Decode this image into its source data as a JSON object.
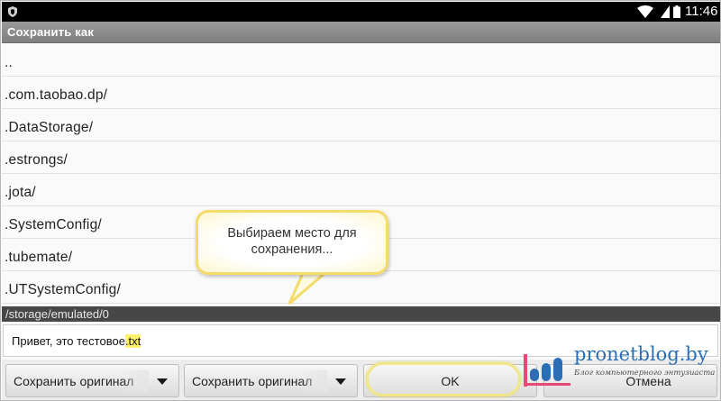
{
  "status_bar": {
    "time": "11:46",
    "icons": [
      "shield-icon",
      "wifi-icon",
      "signal-icon",
      "battery-icon"
    ]
  },
  "dialog": {
    "title": "Сохранить как"
  },
  "file_list": {
    "items": [
      {
        "label": ".."
      },
      {
        "label": ".com.taobao.dp/"
      },
      {
        "label": ".DataStorage/"
      },
      {
        "label": ".estrongs/"
      },
      {
        "label": ".jota/"
      },
      {
        "label": ".SystemConfig/"
      },
      {
        "label": ".tubemate/"
      },
      {
        "label": ".UTSystemConfig/"
      }
    ]
  },
  "path": "/storage/emulated/0",
  "filename": {
    "name": "Привет, это тестовое",
    "extension": ".txt"
  },
  "buttons": {
    "save_option_1": "Сохранить оригинал",
    "save_option_2": "Сохранить оригинал",
    "ok": "OK",
    "cancel": "Отмена"
  },
  "callout": {
    "line1": "Выбираем место для",
    "line2": "сохранения..."
  },
  "watermark": {
    "site": "pronetblog.by",
    "tagline": "Блог компьютерного энтузиаста"
  },
  "colors": {
    "status_bar": "#000000",
    "title_bar": "#8c8c8c",
    "path_bar": "#474747",
    "callout_border": "#f4dc6a",
    "highlight": "#fff36e",
    "watermark_blue": "#2a6fb6"
  }
}
